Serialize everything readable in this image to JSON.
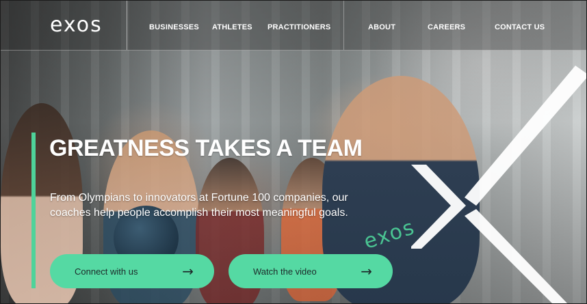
{
  "header": {
    "logo": "exos",
    "nav": [
      "BUSINESSES",
      "ATHLETES",
      "PRACTITIONERS",
      "ABOUT",
      "CAREERS",
      "CONTACT US"
    ]
  },
  "hero": {
    "headline": "GREATNESS TAKES A TEAM",
    "subtext": "From Olympians to innovators at Fortune 100 companies, our coaches help people accomplish their most meaningful goals.",
    "shirt_logo": "exos",
    "cta_primary": "Connect with us",
    "cta_secondary": "Watch the video",
    "arrow": "→"
  },
  "colors": {
    "accent": "#55d9a3",
    "accent_bar": "#4ed39a",
    "text_on_dark": "#ffffff"
  },
  "icons": {
    "arrow": "arrow-right-icon",
    "x_graphic": "x-mark-graphic"
  }
}
